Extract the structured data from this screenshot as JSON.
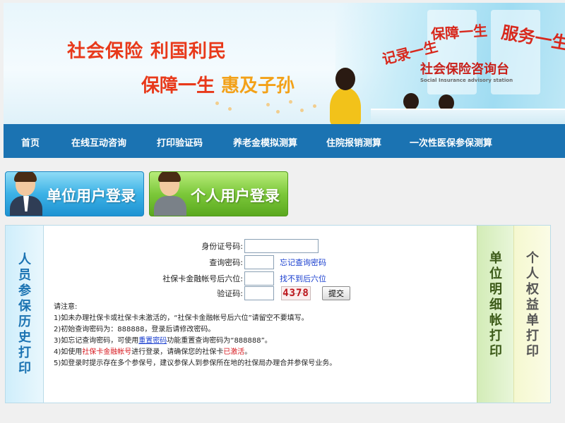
{
  "banner": {
    "slogan_line1": "社会保险  利国利民",
    "slogan_line2a": "保障一生",
    "slogan_line2b": "惠及子孙",
    "wall_text1": "记录一生",
    "wall_text2": "保障一生",
    "wall_text3": "服务一生",
    "desk_title": "社会保险咨询台",
    "desk_subtitle": "Social Insurance advisory station"
  },
  "nav": {
    "items": [
      "首页",
      "在线互动咨询",
      "打印验证码",
      "养老金模拟测算",
      "住院报销测算",
      "一次性医保参保测算"
    ]
  },
  "login": {
    "unit_label": "单位用户登录",
    "person_label": "个人用户登录"
  },
  "sidebar_left": {
    "label": "人员参保历史打印"
  },
  "sidebar_right": {
    "unit_detail": "单位明细帐打印",
    "personal_rights": "个人权益单打印"
  },
  "form": {
    "id_label": "身份证号码:",
    "id_value": "",
    "password_label": "查询密码:",
    "password_value": "",
    "forgot_link": "忘记查询密码",
    "bank_label": "社保卡金融帐号后六位:",
    "bank_value": "",
    "bank_link": "找不到后六位",
    "captcha_label": "验证码:",
    "captcha_value": "",
    "captcha_code": "4378",
    "submit_label": "提交"
  },
  "notes": {
    "title": "请注意:",
    "line1": "1)如未办理社保卡或社保卡未激活的，“社保卡金融帐号后六位”请留空不要填写。",
    "line2": "2)初始查询密码为：888888，登录后请修改密码。",
    "line3a": "3)如忘记查询密码，可使用",
    "line3_link": "重置密码",
    "line3b": "功能重置查询密码为“888888”。",
    "line4a": "4)如使用",
    "line4_red1": "社保卡金融帐号",
    "line4b": "进行登录，请确保您的社保卡",
    "line4_red2": "已激活",
    "line4c": "。",
    "line5": "5)如登录时提示存在多个参保号，建议参保人到参保所在地的社保局办理合并参保号业务。"
  }
}
